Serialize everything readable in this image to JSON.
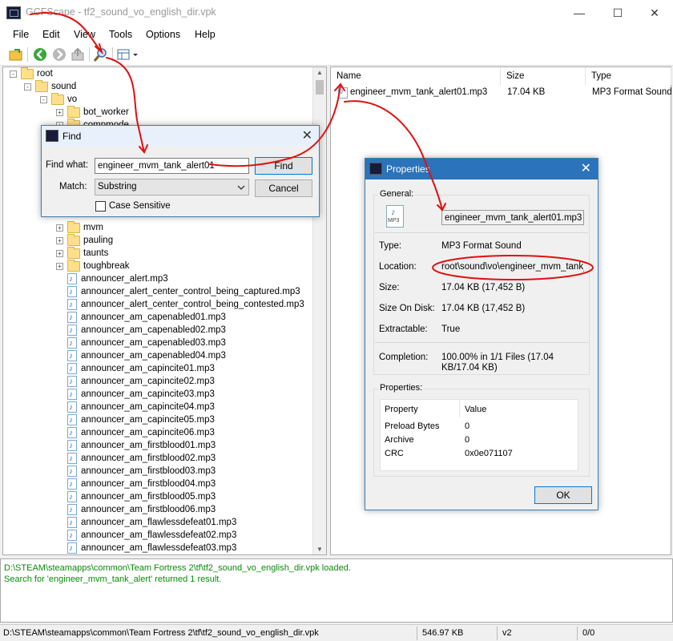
{
  "window": {
    "title": "GCFScape - tf2_sound_vo_english_dir.vpk"
  },
  "window_controls": {
    "minimize": "—",
    "maximize": "☐",
    "close": "✕"
  },
  "menu": [
    "File",
    "Edit",
    "View",
    "Tools",
    "Options",
    "Help"
  ],
  "tree": {
    "root": "root",
    "sound": "sound",
    "vo": "vo",
    "folders_top": [
      "bot_worker",
      "compmode"
    ],
    "folders_bottom": [
      "mvm",
      "pauling",
      "taunts",
      "toughbreak"
    ],
    "files": [
      "announcer_alert.mp3",
      "announcer_alert_center_control_being_captured.mp3",
      "announcer_alert_center_control_being_contested.mp3",
      "announcer_am_capenabled01.mp3",
      "announcer_am_capenabled02.mp3",
      "announcer_am_capenabled03.mp3",
      "announcer_am_capenabled04.mp3",
      "announcer_am_capincite01.mp3",
      "announcer_am_capincite02.mp3",
      "announcer_am_capincite03.mp3",
      "announcer_am_capincite04.mp3",
      "announcer_am_capincite05.mp3",
      "announcer_am_capincite06.mp3",
      "announcer_am_firstblood01.mp3",
      "announcer_am_firstblood02.mp3",
      "announcer_am_firstblood03.mp3",
      "announcer_am_firstblood04.mp3",
      "announcer_am_firstblood05.mp3",
      "announcer_am_firstblood06.mp3",
      "announcer_am_flawlessdefeat01.mp3",
      "announcer_am_flawlessdefeat02.mp3",
      "announcer_am_flawlessdefeat03.mp3"
    ]
  },
  "list": {
    "columns": [
      "Name",
      "Size",
      "Type"
    ],
    "rows": [
      {
        "name": "engineer_mvm_tank_alert01.mp3",
        "size": "17.04 KB",
        "type": "MP3 Format Sound"
      }
    ]
  },
  "find_dialog": {
    "title": "Find",
    "find_what_label": "Find what:",
    "find_what_value": "engineer_mvm_tank_alert01",
    "match_label": "Match:",
    "match_value": "Substring",
    "case_sensitive_label": "Case Sensitive",
    "find_button": "Find",
    "cancel_button": "Cancel"
  },
  "properties_dialog": {
    "title": "Properties",
    "general_label": "General:",
    "file_icon_text": "MP3",
    "filename": "engineer_mvm_tank_alert01.mp3",
    "type_label": "Type:",
    "type_value": "MP3 Format Sound",
    "location_label": "Location:",
    "location_value": "root\\sound\\vo\\engineer_mvm_tank_a",
    "size_label": "Size:",
    "size_value": "17.04 KB (17,452 B)",
    "size_on_disk_label": "Size On Disk:",
    "size_on_disk_value": "17.04 KB (17,452 B)",
    "extractable_label": "Extractable:",
    "extractable_value": "True",
    "completion_label": "Completion:",
    "completion_value": "100.00% in 1/1 Files (17.04 KB/17.04 KB)",
    "properties_label": "Properties:",
    "prop_columns": [
      "Property",
      "Value"
    ],
    "prop_rows": [
      {
        "property": "Preload Bytes",
        "value": "0"
      },
      {
        "property": "Archive",
        "value": "0"
      },
      {
        "property": "CRC",
        "value": "0x0e071107"
      }
    ],
    "ok_button": "OK"
  },
  "log": [
    "D:\\STEAM\\steamapps\\common\\Team Fortress 2\\tf\\tf2_sound_vo_english_dir.vpk loaded.",
    "Search for 'engineer_mvm_tank_alert' returned 1 result."
  ],
  "status": {
    "path": "D:\\STEAM\\steamapps\\common\\Team Fortress 2\\tf\\tf2_sound_vo_english_dir.vpk",
    "size": "546.97 KB",
    "version": "v2",
    "count": "0/0"
  },
  "colors": {
    "annotation": "#e01010",
    "log_text": "#0a8a0a",
    "dialog_border": "#3c7fb1"
  }
}
